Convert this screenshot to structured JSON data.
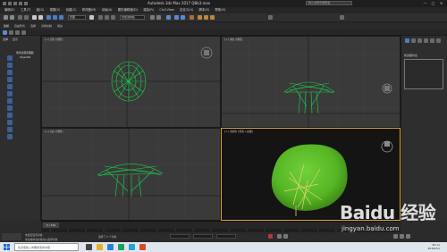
{
  "window": {
    "title": "Autodesk 3ds Max 2017   Q8b3.max",
    "search_placeholder": "键入关键字或短语",
    "controls": [
      "—",
      "□",
      "✕"
    ]
  },
  "menu": {
    "items": [
      "编辑(E)",
      "工具(T)",
      "组(G)",
      "视图(V)",
      "创建(C)",
      "修改器(M)",
      "动画(A)",
      "图形编辑器(D)",
      "渲染(R)",
      "Civil View",
      "自定义(U)",
      "脚本(S)",
      "帮助(H)"
    ]
  },
  "toolbar": {
    "view_dropdown": "视图",
    "selection_set": "创建选择集"
  },
  "toolbar2": {
    "tabs": [
      "建模",
      "自由形式",
      "选择",
      "对象绘制",
      "填充"
    ]
  },
  "left_panel": {
    "tabs": [
      "选择",
      "显示"
    ],
    "scene_root": "场景资源管理器",
    "scene_item": "Object01"
  },
  "viewports": {
    "top_left": {
      "label": "[+] [顶] [线框]"
    },
    "top_right": {
      "label": "[+] [前] [线框]"
    },
    "bottom_left": {
      "label": "[+] [左] [线框]"
    },
    "bottom_right": {
      "label": "[+] [透视] [真实+边面]"
    }
  },
  "right_panel": {
    "title": "修改器列表"
  },
  "timeline": {
    "slider": "0 / 100"
  },
  "status": {
    "line1": "未选定任何对象",
    "line2": "单击或单击并拖动以选择对象",
    "selected": "选择了 0 个对象"
  },
  "taskbar": {
    "search_placeholder": "在这里输入你要搜索的内容",
    "time": "20:11",
    "date": "2019/3/1"
  },
  "watermark": {
    "brand": "Baidu 经验",
    "url": "jingyan.baidu.com"
  },
  "colors": {
    "tree_green": "#19d24b",
    "blob_green": "#56b524",
    "branch_yellow": "#e8d26a",
    "viewport_bg": "#3a3a3a",
    "active_border": "#e0a030"
  }
}
